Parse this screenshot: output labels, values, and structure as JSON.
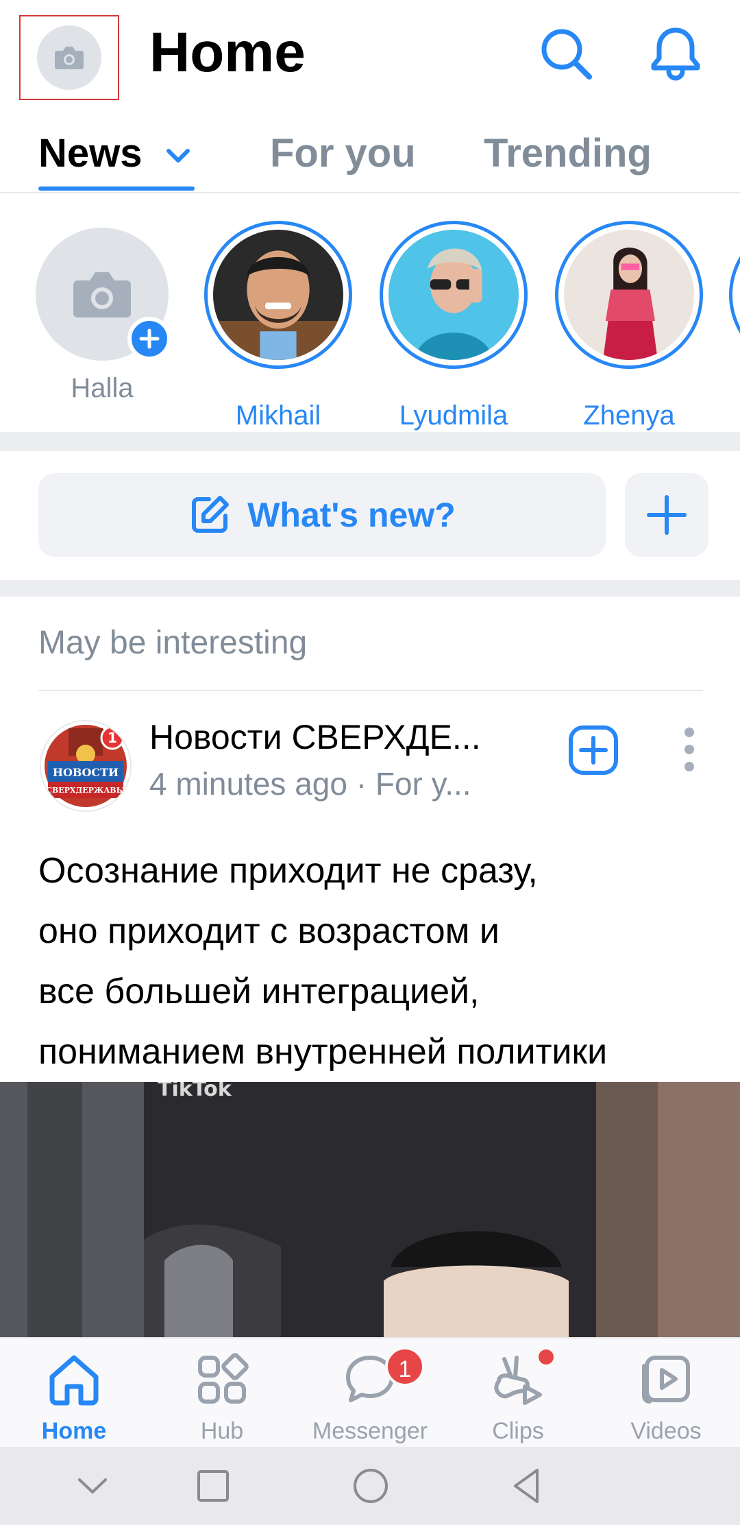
{
  "header": {
    "title": "Home",
    "avatar_icon": "camera-icon",
    "search_icon": "search-icon",
    "bell_icon": "bell-icon"
  },
  "tabs": [
    {
      "label": "News",
      "active": true
    },
    {
      "label": "For you",
      "active": false
    },
    {
      "label": "Trending",
      "active": false
    }
  ],
  "stories": {
    "my_story": {
      "name": "Halla"
    },
    "items": [
      {
        "name": "Mikhail"
      },
      {
        "name": "Lyudmila"
      },
      {
        "name": "Zhenya"
      }
    ]
  },
  "composer": {
    "label": "What's new?"
  },
  "feed": {
    "section_title": "May be interesting",
    "post": {
      "author": "Новости СВЕРХДЕ...",
      "meta": "4 minutes ago · For y...",
      "avatar_badge": "1",
      "avatar_text_1": "НОВОСТИ",
      "avatar_text_2": "СВЕРХДЕРЖАВЫ",
      "text_lines": [
        "Осознание приходит не сразу,",
        "оно приходит с возрастом и",
        "все большей интеграцией,",
        "пониманием внутренней политики"
      ],
      "video_watermark": "TikTok"
    }
  },
  "bottom_nav": [
    {
      "label": "Home",
      "icon": "home-icon",
      "active": true
    },
    {
      "label": "Hub",
      "icon": "grid-icon",
      "active": false
    },
    {
      "label": "Messenger",
      "icon": "chat-icon",
      "active": false,
      "badge": "1"
    },
    {
      "label": "Clips",
      "icon": "clips-icon",
      "active": false,
      "dot": true
    },
    {
      "label": "Videos",
      "icon": "video-icon",
      "active": false
    }
  ],
  "colors": {
    "accent": "#2787f5",
    "muted": "#818c99",
    "badge": "#e64646"
  }
}
